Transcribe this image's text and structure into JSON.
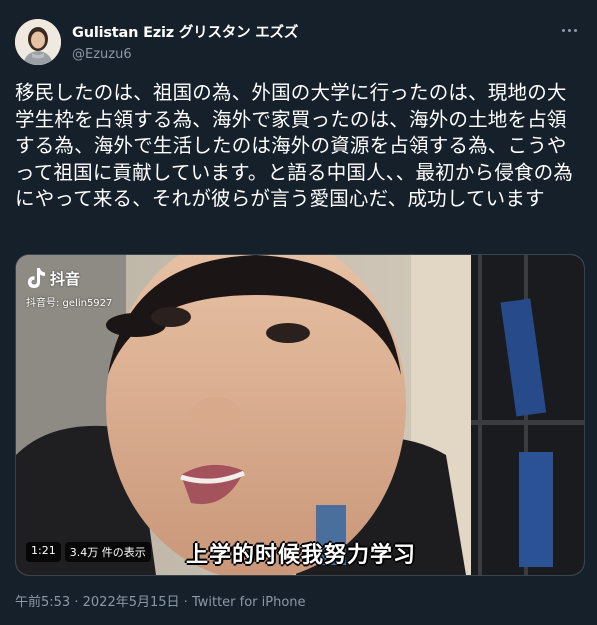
{
  "author": {
    "display_name": "Gulistan Eziz グリスタン エズズ",
    "handle": "@Ezuzu6",
    "avatar_icon": "profile-photo-avatar"
  },
  "more_icon": "more-horizontal-icon",
  "tweet": {
    "text": "移民したのは、祖国の為、外国の大学に行ったのは、現地の大学生枠を占領する為、海外で家買ったのは、海外の土地を占領する為、海外で生活したのは海外の資源を占領する為、こうやって祖国に貢献しています。と語る中国人、、最初から侵食の為にやって来る、それが彼らが言う愛国心だ、成功しています"
  },
  "media": {
    "watermark_app": "抖音",
    "watermark_id": "抖音号: gelin5927",
    "subtitle": "上学的时候我努力学习",
    "duration": "1:21",
    "views": "3.4万 件の表示"
  },
  "meta": {
    "time": "午前5:53",
    "separator": "·",
    "date": "2022年5月15日",
    "source": "Twitter for iPhone"
  },
  "colors": {
    "background": "#15202b",
    "text": "#ffffff",
    "secondary": "#8b98a5",
    "border": "#38444d"
  }
}
